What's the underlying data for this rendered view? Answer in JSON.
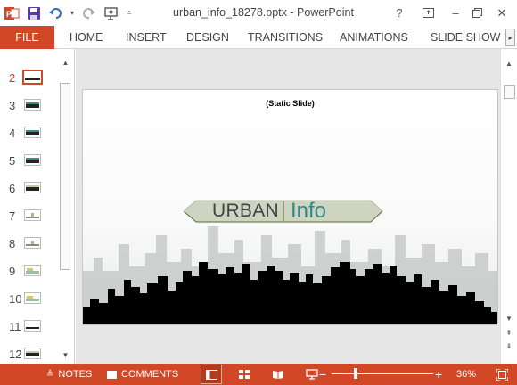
{
  "window": {
    "title": "urban_info_18278.pptx - PowerPoint",
    "help_label": "?",
    "minimize_label": "–",
    "close_label": "✕"
  },
  "ribbon": {
    "tabs": [
      "FILE",
      "HOME",
      "INSERT",
      "DESIGN",
      "TRANSITIONS",
      "ANIMATIONS",
      "SLIDE SHOW"
    ]
  },
  "thumbnails": {
    "selected": "2",
    "items": [
      "2",
      "3",
      "4",
      "5",
      "6",
      "7",
      "8",
      "9",
      "10",
      "11",
      "12"
    ]
  },
  "slide": {
    "caption": "(Static Slide)",
    "banner_word_1": "URBAN",
    "banner_word_2": "Info"
  },
  "statusbar": {
    "notes_label": "NOTES",
    "comments_label": "COMMENTS",
    "zoom_level": "36%",
    "zoom_fraction": 0.36
  },
  "colors": {
    "accent": "#d24726",
    "info_text": "#2e8a87",
    "banner_fill": "#cfd3c2"
  }
}
